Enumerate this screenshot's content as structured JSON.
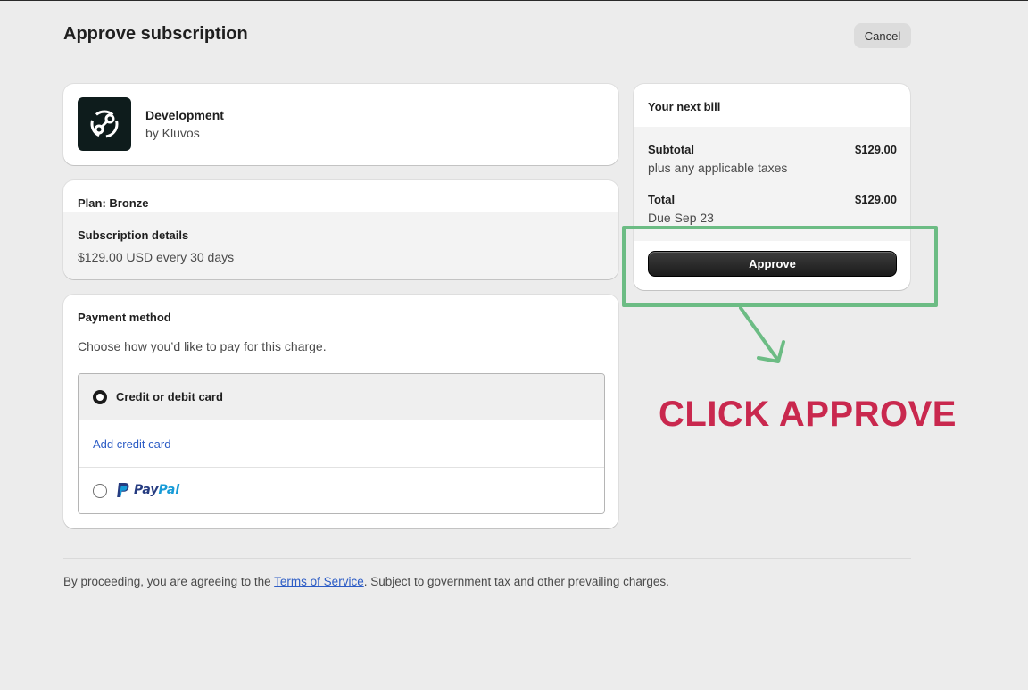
{
  "header": {
    "title": "Approve subscription",
    "cancel_label": "Cancel"
  },
  "app": {
    "name": "Development",
    "by": "by Kluvos",
    "logo_icon": "kluvos-logo-icon"
  },
  "plan": {
    "title": "Plan: Bronze",
    "details_title": "Subscription details",
    "price_text": "$129.00 USD every 30 days"
  },
  "payment": {
    "title": "Payment method",
    "description": "Choose how you’d like to pay for this charge.",
    "options": [
      {
        "label": "Credit or debit card",
        "selected": true
      },
      {
        "label": "PayPal",
        "selected": false
      }
    ],
    "add_card_label": "Add credit card",
    "paypal_pay": "Pay",
    "paypal_pal": "Pal"
  },
  "bill": {
    "title": "Your next bill",
    "subtotal_label": "Subtotal",
    "subtotal_value": "$129.00",
    "taxes_note": "plus any applicable taxes",
    "total_label": "Total",
    "total_value": "$129.00",
    "due": "Due Sep 23",
    "approve_label": "Approve"
  },
  "annotation": {
    "callout": "CLICK APPROVE",
    "highlight_color": "#6cbc84",
    "callout_color": "#c9284e"
  },
  "footer": {
    "prefix": "By proceeding, you are agreeing to the ",
    "tos_link": "Terms of Service",
    "suffix": ". Subject to government tax and other prevailing charges."
  },
  "colors": {
    "background": "#ececec",
    "link": "#2c5cc5",
    "primary_button": "#1b1b1b"
  }
}
